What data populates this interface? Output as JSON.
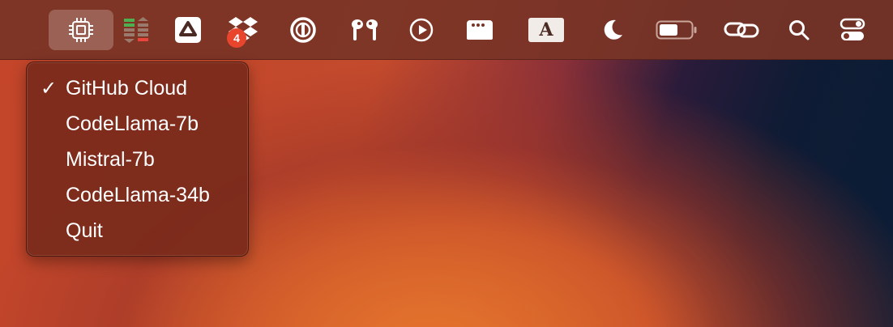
{
  "menubar": {
    "icons": [
      {
        "name": "cpu-chip-icon",
        "active": true
      },
      {
        "name": "network-meter-icon"
      },
      {
        "name": "google-drive-icon"
      },
      {
        "name": "dropbox-icon",
        "badge": "4"
      },
      {
        "name": "1password-icon"
      },
      {
        "name": "airpods-icon"
      },
      {
        "name": "play-circle-icon"
      },
      {
        "name": "window-dots-icon"
      },
      {
        "name": "input-source-icon",
        "text": "A"
      },
      {
        "name": "moon-icon"
      },
      {
        "name": "battery-icon"
      },
      {
        "name": "link-icon"
      },
      {
        "name": "search-icon"
      },
      {
        "name": "control-center-icon"
      }
    ]
  },
  "dropdown": {
    "checkmark": "✓",
    "items": [
      {
        "label": "GitHub Cloud",
        "checked": true
      },
      {
        "label": "CodeLlama-7b",
        "checked": false
      },
      {
        "label": "Mistral-7b",
        "checked": false
      },
      {
        "label": "CodeLlama-34b",
        "checked": false
      },
      {
        "label": "Quit",
        "checked": false
      }
    ]
  },
  "colors": {
    "menubar": "#783426",
    "menu_bg": "#7a2a1c",
    "badge": "#e8452c",
    "meter_green": "#4caf50",
    "meter_red": "#e8453c"
  }
}
